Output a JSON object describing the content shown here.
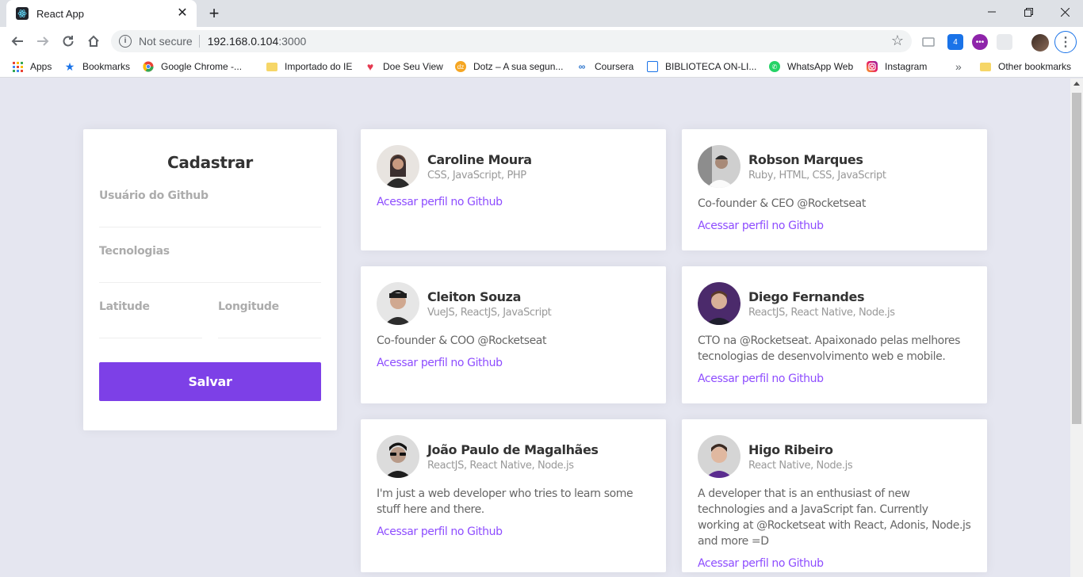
{
  "browser": {
    "tab_title": "React App",
    "security_label": "Not secure",
    "url_host": "192.168.0.104",
    "url_port": ":3000",
    "extension_badge": "4"
  },
  "bookmarks": [
    {
      "label": "Apps",
      "icon": "apps-grid-icon"
    },
    {
      "label": "Bookmarks",
      "icon": "star-icon"
    },
    {
      "label": "Google Chrome -...",
      "icon": "chrome-icon"
    },
    {
      "label": "Importado do IE",
      "icon": "folder-icon"
    },
    {
      "label": "Doe Seu View",
      "icon": "heart-icon"
    },
    {
      "label": "Dotz – A sua segun...",
      "icon": "dotz-icon"
    },
    {
      "label": "Coursera",
      "icon": "coursera-icon"
    },
    {
      "label": "BIBLIOTECA ON-LI...",
      "icon": "library-icon"
    },
    {
      "label": "WhatsApp Web",
      "icon": "whatsapp-icon"
    },
    {
      "label": "Instagram",
      "icon": "instagram-icon"
    },
    {
      "label": "»",
      "icon": "chevron-more-icon"
    },
    {
      "label": "Other bookmarks",
      "icon": "folder-icon"
    }
  ],
  "form": {
    "title": "Cadastrar",
    "github_user_label": "Usuário do Github",
    "github_user_value": "",
    "techs_label": "Tecnologias",
    "techs_value": "",
    "latitude_label": "Latitude",
    "latitude_value": "",
    "longitude_label": "Longitude",
    "longitude_value": "",
    "save_label": "Salvar"
  },
  "link_label": "Acessar perfil no Github",
  "colors": {
    "accent": "#7d40e7",
    "link": "#8e4dff",
    "background": "#e5e6f0"
  },
  "devs": [
    {
      "name": "Caroline Moura",
      "techs": "CSS, JavaScript, PHP",
      "bio": "",
      "avatar_color": "#3b2f2f"
    },
    {
      "name": "Robson Marques",
      "techs": "Ruby, HTML, CSS, JavaScript",
      "bio": "Co-founder & CEO @Rocketseat",
      "avatar_color": "#d8d8d8"
    },
    {
      "name": "Cleiton Souza",
      "techs": "VueJS, ReactJS, JavaScript",
      "bio": "Co-founder & COO @Rocketseat",
      "avatar_color": "#2d2d2d"
    },
    {
      "name": "Diego Fernandes",
      "techs": "ReactJS, React Native, Node.js",
      "bio": "CTO na @Rocketseat. Apaixonado pelas melhores tecnologias de desenvolvimento web e mobile.",
      "avatar_color": "#4b2a6b"
    },
    {
      "name": "João Paulo de Magalhães",
      "techs": "ReactJS, React Native, Node.js",
      "bio": "I'm just a web developer who tries to learn some stuff here and there.",
      "avatar_color": "#1e1e1e"
    },
    {
      "name": "Higo Ribeiro",
      "techs": "React Native, Node.js",
      "bio": "A developer that is an enthusiast of new technologies and a JavaScript fan. Currently working at @Rocketseat with React, Adonis, Node.js and more =D",
      "avatar_color": "#bfbfbf"
    }
  ]
}
